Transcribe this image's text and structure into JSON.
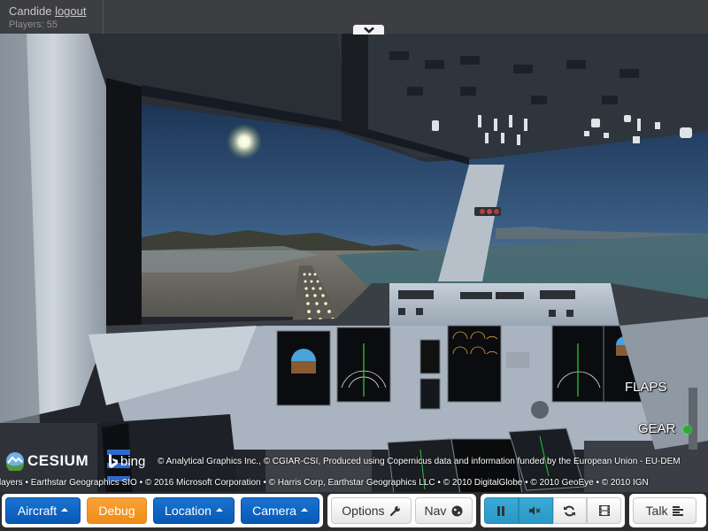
{
  "topbar": {
    "username": "Candide",
    "logout_label": "logout",
    "players_label": "Players: 55",
    "collapse_icon": "chevron-down-icon"
  },
  "hud": {
    "flaps_label": "FLAPS",
    "gear_label": "GEAR",
    "gear_status_color": "#2fa838"
  },
  "credits": {
    "cesium_label": "CESIUM",
    "bing_label": "bing",
    "line1": "© Analytical Graphics Inc., © CGIAR-CSI, Produced using Copernicus data and information funded by the European Union - EU-DEM",
    "line2": "layers • Earthstar Geographics SIO • © 2016 Microsoft Corporation • © Harris Corp, Earthstar Geographics LLC • © 2010 DigitalGlobe • © 2010 GeoEye • © 2010 IGN"
  },
  "toolbar": {
    "aircraft_label": "Aircraft",
    "debug_label": "Debug",
    "location_label": "Location",
    "camera_label": "Camera",
    "options_label": "Options",
    "nav_label": "Nav",
    "talk_label": "Talk",
    "pause_icon": "pause-icon",
    "mute_icon": "mute-icon",
    "reset_icon": "refresh-icon",
    "film_icon": "film-icon",
    "colors": {
      "primary": "#0f66c4",
      "warning": "#f29a2e",
      "info": "#32a2cf"
    }
  }
}
